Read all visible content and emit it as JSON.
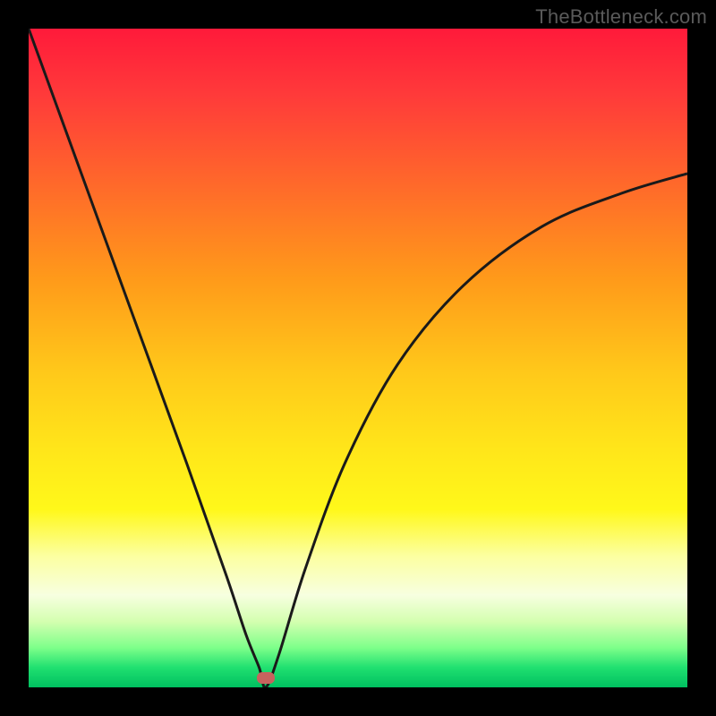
{
  "watermark": {
    "text": "TheBottleneck.com"
  },
  "colors": {
    "frame": "#000000",
    "curve_stroke": "#1a1a1a",
    "marker_fill": "#c7635e"
  },
  "chart_data": {
    "type": "line",
    "title": "",
    "xlabel": "",
    "ylabel": "",
    "xlim": [
      0,
      100
    ],
    "ylim": [
      0,
      100
    ],
    "grid": false,
    "legend": false,
    "marker": {
      "x": 36,
      "y": 1.5
    },
    "series": [
      {
        "name": "bottleneck-curve",
        "x": [
          0,
          8,
          16,
          24,
          30,
          33,
          35,
          36,
          38,
          42,
          48,
          56,
          66,
          78,
          90,
          100
        ],
        "y": [
          100,
          78,
          56,
          34,
          17,
          8,
          3,
          0,
          5,
          18,
          34,
          49,
          61,
          70,
          75,
          78
        ]
      }
    ]
  }
}
